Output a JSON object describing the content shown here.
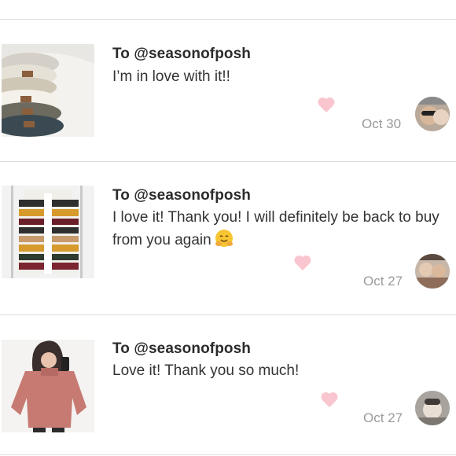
{
  "feed": {
    "items": [
      {
        "recipient_prefix": "To ",
        "recipient": "@seasonofposh",
        "message": "I’m in love with it!!",
        "date": "Oct 30",
        "image_icon": "stacked-knit-beanies-photo",
        "heart_color": "#f9c6cf",
        "has_emoji": false
      },
      {
        "recipient_prefix": "To ",
        "recipient": "@seasonofposh",
        "message": "I love it! Thank you! I will definitely be back to buy from you again",
        "date": "Oct 27",
        "image_icon": "striped-cardigan-photo",
        "heart_color": "#f9c6cf",
        "has_emoji": true,
        "emoji_icon": "hugging-face-emoji"
      },
      {
        "recipient_prefix": "To ",
        "recipient": "@seasonofposh",
        "message": "Love it! Thank you so much!",
        "date": "Oct 27",
        "image_icon": "pink-sweater-photo",
        "heart_color": "#f9c6cf",
        "has_emoji": false
      }
    ]
  },
  "colors": {
    "divider": "#dcdcdc",
    "text": "#2b2b2b",
    "date": "#9a9a9a",
    "heart": "#f9c6cf"
  }
}
